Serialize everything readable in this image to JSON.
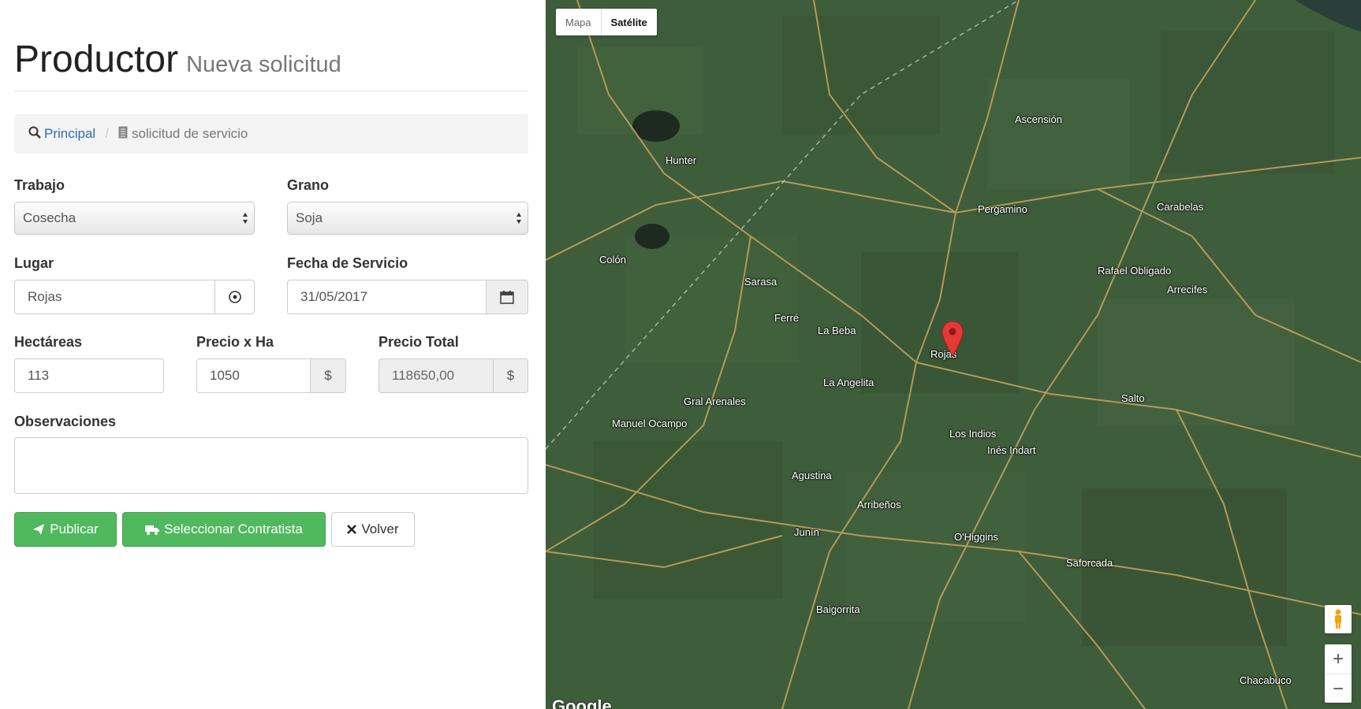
{
  "header": {
    "title": "Productor",
    "subtitle": "Nueva solicitud"
  },
  "breadcrumb": {
    "home": "Principal",
    "current": "solicitud de servicio"
  },
  "form": {
    "trabajo": {
      "label": "Trabajo",
      "value": "Cosecha"
    },
    "grano": {
      "label": "Grano",
      "value": "Soja"
    },
    "lugar": {
      "label": "Lugar",
      "value": "Rojas"
    },
    "fecha": {
      "label": "Fecha de Servicio",
      "value": "31/05/2017"
    },
    "hectareas": {
      "label": "Hectáreas",
      "value": "113"
    },
    "precio_ha": {
      "label": "Precio x Ha",
      "value": "1050",
      "currency": "$"
    },
    "precio_total": {
      "label": "Precio Total",
      "value": "118650,00",
      "currency": "$"
    },
    "observaciones": {
      "label": "Observaciones",
      "value": ""
    }
  },
  "buttons": {
    "publicar": "Publicar",
    "contratista": "Seleccionar Contratista",
    "volver": "Volver"
  },
  "map": {
    "type_controls": {
      "map": "Mapa",
      "satellite": "Satélite",
      "selected": "Satélite"
    },
    "labels": [
      "Pergamino",
      "Rojas",
      "Salto",
      "Chacabuco",
      "Junín",
      "Colón",
      "Arrecifes",
      "Carabelas",
      "La Beba",
      "Los Indios",
      "Agustina",
      "Gral Arenales",
      "Sarasa",
      "La Angelita",
      "Hunter",
      "Manuel Ocampo",
      "Arribeños",
      "Ferré",
      "Rafael Obligado",
      "Inés Indart",
      "O'Higgins",
      "Saforcada",
      "Ascensión",
      "Baigorrita"
    ],
    "controls": {
      "zoom_in": "+",
      "zoom_out": "−"
    },
    "attribution": "Google"
  },
  "colors": {
    "button_green": "#50b85d",
    "link_blue": "#2a6fb0",
    "marker_red": "#e53935"
  }
}
